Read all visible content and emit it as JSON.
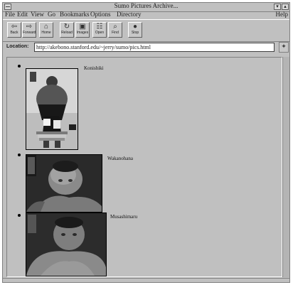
{
  "window": {
    "title": "Sumo Pictures Archive..."
  },
  "menu": [
    "File",
    "Edit",
    "View",
    "Go",
    "Bookmarks",
    "Options",
    "Directory"
  ],
  "help_label": "Help",
  "toolbar": [
    {
      "label": "Back",
      "icon": "⇦"
    },
    {
      "label": "Forward",
      "icon": "⇨"
    },
    {
      "label": "Home",
      "icon": "⌂"
    },
    {
      "label": "Reload",
      "icon": "↻"
    },
    {
      "label": "Images",
      "icon": "▣"
    },
    {
      "label": "Open",
      "icon": "☷"
    },
    {
      "label": "Find",
      "icon": "⌕"
    },
    {
      "label": "Stop",
      "icon": "●"
    }
  ],
  "location": {
    "label": "Location:",
    "url": "http://akebono.stanford.edu/~jerry/sumo/pics.html"
  },
  "wrestlers": [
    {
      "name": "Konishiki"
    },
    {
      "name": "Wakanohana"
    },
    {
      "name": "Musashimaru"
    }
  ]
}
